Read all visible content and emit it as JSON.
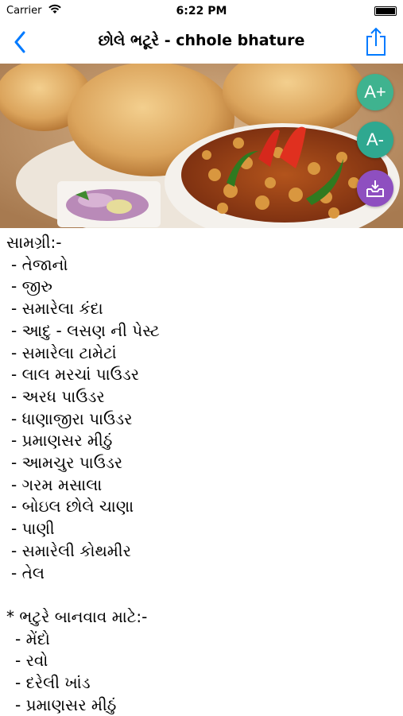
{
  "status_bar": {
    "carrier": "Carrier",
    "time": "6:22 PM"
  },
  "nav": {
    "title": "છોલે ભટૂરે  - chhole bhature",
    "back_icon": "chevron-left-icon",
    "share_icon": "share-icon"
  },
  "hero": {
    "description_icon": "food-photo"
  },
  "font_controls": {
    "increase": "A+",
    "decrease": "A-",
    "download_icon": "download-tray-icon"
  },
  "colors": {
    "tint": "#007aff",
    "fab_increase": "#3fb38f",
    "fab_decrease": "#2fa890",
    "fab_download": "#8e4fc0"
  },
  "ingredients": {
    "heading": "સામગ્રી:-",
    "items": [
      "- તેજાનો",
      "- જીરુ",
      "- સમારેલા કંદા",
      "- આદુ - લસણ ની પેસ્ટ",
      "- સમારેલા ટામેટાં",
      "- લાલ મરચાં પાઉડર",
      "- અરધ પાઉડર",
      "- ધાણાજીરા પાઉડર",
      "- પ્રમાણસર મીઠું",
      "- આમચુર  પાઉડર",
      "- ગરમ મસાલા",
      "- બોઇલ છોલે ચાણા",
      "- પાણી",
      "- સમારેલી કોથમીર",
      "- તેલ"
    ]
  },
  "bhature": {
    "heading": "* ભટુરે બાનવાવ માટે:-",
    "items": [
      "- મેંદો",
      "- રવો",
      "- દરેલી ખાંડ",
      "- પ્રમાણસર મીઠું"
    ]
  }
}
